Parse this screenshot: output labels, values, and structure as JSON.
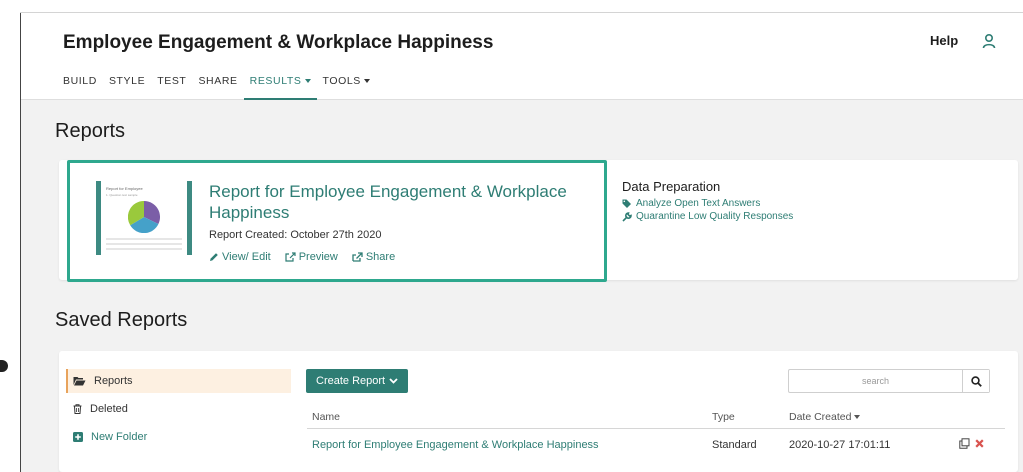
{
  "header": {
    "survey_title": "Employee Engagement & Workplace Happiness",
    "help_label": "Help"
  },
  "nav": {
    "items": [
      {
        "label": "BUILD"
      },
      {
        "label": "STYLE"
      },
      {
        "label": "TEST"
      },
      {
        "label": "SHARE"
      },
      {
        "label": "RESULTS"
      },
      {
        "label": "TOOLS"
      }
    ],
    "active": "RESULTS"
  },
  "reports": {
    "section_title": "Reports",
    "featured": {
      "name": "Report for Employee Engagement & Workplace Happiness",
      "created": "Report Created: October 27th 2020",
      "thumbnail": {
        "title": "Report for Employee",
        "subtitle": "1. Question text sample"
      },
      "actions": {
        "view_edit": "View/ Edit",
        "preview": "Preview",
        "share": "Share"
      }
    },
    "data_preparation": {
      "title": "Data Preparation",
      "analyze": "Analyze Open Text Answers",
      "quarantine": "Quarantine Low Quality Responses"
    }
  },
  "saved": {
    "section_title": "Saved Reports",
    "folders": {
      "reports": "Reports",
      "deleted": "Deleted",
      "new_folder": "New Folder"
    },
    "create_button": "Create Report",
    "search": {
      "placeholder": "search"
    },
    "table": {
      "headers": {
        "name": "Name",
        "type": "Type",
        "date": "Date Created"
      },
      "rows": [
        {
          "name": "Report for Employee Engagement & Workplace Happiness",
          "type": "Standard",
          "date": "2020-10-27 17:01:11"
        }
      ]
    }
  },
  "colors": {
    "brand": "#2e7d74",
    "highlight": "#2ea88e",
    "delete": "#d9534f",
    "active_folder_bg": "#fdf0e1"
  },
  "icons": [
    "user-icon",
    "pencil-icon",
    "external-link-icon",
    "share-icon",
    "tag-icon",
    "wrench-icon",
    "folder-open-icon",
    "trash-icon",
    "plus-square-icon",
    "chevron-down-icon",
    "search-icon",
    "copy-icon",
    "delete-icon"
  ]
}
